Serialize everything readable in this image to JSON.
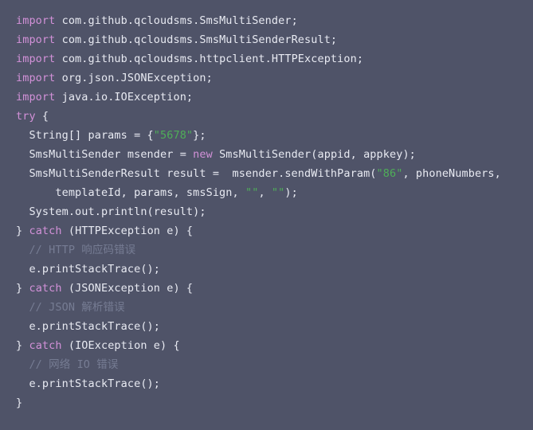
{
  "editor": {
    "language": "Java",
    "background_color": "#4f5368",
    "colors": {
      "keyword": "#d291d8",
      "string": "#4fae58",
      "comment": "#767c93",
      "plain_text": "#e8eaf2"
    },
    "lines": [
      {
        "index": 1,
        "text": "import com.github.qcloudsms.SmsMultiSender;",
        "tokens": [
          {
            "t": "import",
            "k": "keyword"
          },
          {
            "t": " com.github.qcloudsms.SmsMultiSender;",
            "k": "plain"
          }
        ]
      },
      {
        "index": 2,
        "text": "import com.github.qcloudsms.SmsMultiSenderResult;",
        "tokens": [
          {
            "t": "import",
            "k": "keyword"
          },
          {
            "t": " com.github.qcloudsms.SmsMultiSenderResult;",
            "k": "plain"
          }
        ]
      },
      {
        "index": 3,
        "text": "import com.github.qcloudsms.httpclient.HTTPException;",
        "tokens": [
          {
            "t": "import",
            "k": "keyword"
          },
          {
            "t": " com.github.qcloudsms.httpclient.HTTPException;",
            "k": "plain"
          }
        ]
      },
      {
        "index": 4,
        "text": "import org.json.JSONException;",
        "tokens": [
          {
            "t": "import",
            "k": "keyword"
          },
          {
            "t": " org.json.JSONException;",
            "k": "plain"
          }
        ]
      },
      {
        "index": 5,
        "text": "import java.io.IOException;",
        "tokens": [
          {
            "t": "import",
            "k": "keyword"
          },
          {
            "t": " java.io.IOException;",
            "k": "plain"
          }
        ]
      },
      {
        "index": 6,
        "text": "try {",
        "tokens": [
          {
            "t": "try",
            "k": "keyword"
          },
          {
            "t": " {",
            "k": "plain"
          }
        ]
      },
      {
        "index": 7,
        "text": "  String[] params = {\"5678\"};",
        "tokens": [
          {
            "t": "  String[] params = {",
            "k": "plain"
          },
          {
            "t": "\"5678\"",
            "k": "string"
          },
          {
            "t": "};",
            "k": "plain"
          }
        ]
      },
      {
        "index": 8,
        "text": "  SmsMultiSender msender = new SmsMultiSender(appid, appkey);",
        "tokens": [
          {
            "t": "  SmsMultiSender msender = ",
            "k": "plain"
          },
          {
            "t": "new",
            "k": "keyword"
          },
          {
            "t": " SmsMultiSender(appid, appkey);",
            "k": "plain"
          }
        ]
      },
      {
        "index": 9,
        "text": "  SmsMultiSenderResult result =  msender.sendWithParam(\"86\", phoneNumbers,",
        "tokens": [
          {
            "t": "  SmsMultiSenderResult result =  msender.sendWithParam(",
            "k": "plain"
          },
          {
            "t": "\"86\"",
            "k": "string"
          },
          {
            "t": ", phoneNumbers,",
            "k": "plain"
          }
        ]
      },
      {
        "index": 10,
        "text": "      templateId, params, smsSign, \"\", \"\");",
        "tokens": [
          {
            "t": "      templateId, params, smsSign, ",
            "k": "plain"
          },
          {
            "t": "\"\"",
            "k": "string"
          },
          {
            "t": ", ",
            "k": "plain"
          },
          {
            "t": "\"\"",
            "k": "string"
          },
          {
            "t": ");",
            "k": "plain"
          }
        ]
      },
      {
        "index": 11,
        "text": "  System.out.println(result);",
        "tokens": [
          {
            "t": "  System.out.println(result);",
            "k": "plain"
          }
        ]
      },
      {
        "index": 12,
        "text": "} catch (HTTPException e) {",
        "tokens": [
          {
            "t": "} ",
            "k": "plain"
          },
          {
            "t": "catch",
            "k": "keyword"
          },
          {
            "t": " (HTTPException e) {",
            "k": "plain"
          }
        ]
      },
      {
        "index": 13,
        "text": "  // HTTP 响应码错误",
        "tokens": [
          {
            "t": "  // HTTP 响应码错误",
            "k": "comment"
          }
        ]
      },
      {
        "index": 14,
        "text": "  e.printStackTrace();",
        "tokens": [
          {
            "t": "  e.printStackTrace();",
            "k": "plain"
          }
        ]
      },
      {
        "index": 15,
        "text": "} catch (JSONException e) {",
        "tokens": [
          {
            "t": "} ",
            "k": "plain"
          },
          {
            "t": "catch",
            "k": "keyword"
          },
          {
            "t": " (JSONException e) {",
            "k": "plain"
          }
        ]
      },
      {
        "index": 16,
        "text": "  // JSON 解析错误",
        "tokens": [
          {
            "t": "  // JSON 解析错误",
            "k": "comment"
          }
        ]
      },
      {
        "index": 17,
        "text": "  e.printStackTrace();",
        "tokens": [
          {
            "t": "  e.printStackTrace();",
            "k": "plain"
          }
        ]
      },
      {
        "index": 18,
        "text": "} catch (IOException e) {",
        "tokens": [
          {
            "t": "} ",
            "k": "plain"
          },
          {
            "t": "catch",
            "k": "keyword"
          },
          {
            "t": " (IOException e) {",
            "k": "plain"
          }
        ]
      },
      {
        "index": 19,
        "text": "  // 网络 IO 错误",
        "tokens": [
          {
            "t": "  // 网络 IO 错误",
            "k": "comment"
          }
        ]
      },
      {
        "index": 20,
        "text": "  e.printStackTrace();",
        "tokens": [
          {
            "t": "  e.printStackTrace();",
            "k": "plain"
          }
        ]
      },
      {
        "index": 21,
        "text": "}",
        "tokens": [
          {
            "t": "}",
            "k": "plain"
          }
        ]
      }
    ]
  }
}
